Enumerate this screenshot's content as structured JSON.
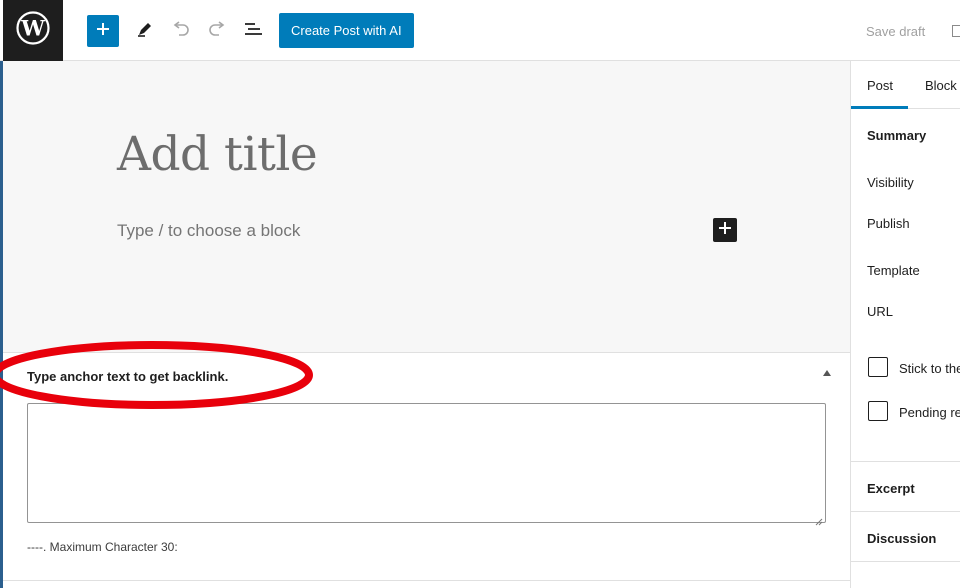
{
  "toolbar": {
    "logo_icon": "wordpress-logo",
    "add_block_icon": "plus-icon",
    "tools_icon": "pencil-icon",
    "undo_icon": "undo-icon",
    "redo_icon": "redo-icon",
    "outline_icon": "list-view-icon",
    "ai_button_label": "Create Post with AI",
    "save_draft_label": "Save draft"
  },
  "editor": {
    "title_placeholder": "Add title",
    "block_placeholder": "Type / to choose a block"
  },
  "metabox": {
    "title": "Type anchor text to get backlink.",
    "textarea_value": "",
    "hint": "----. Maximum Character 30:"
  },
  "sidebar": {
    "tabs": [
      {
        "label": "Post",
        "active": true
      },
      {
        "label": "Block",
        "active": false
      }
    ],
    "summary_title": "Summary",
    "visibility_label": "Visibility",
    "publish_label": "Publish",
    "template_label": "Template",
    "url_label": "URL",
    "sticky_label": "Stick to the",
    "pending_label": "Pending re",
    "excerpt_label": "Excerpt",
    "discussion_label": "Discussion"
  },
  "colors": {
    "accent": "#007cba",
    "dark": "#1e1e1e",
    "highlight": "#e8000b",
    "canvas_bg": "#f7f7f7"
  }
}
